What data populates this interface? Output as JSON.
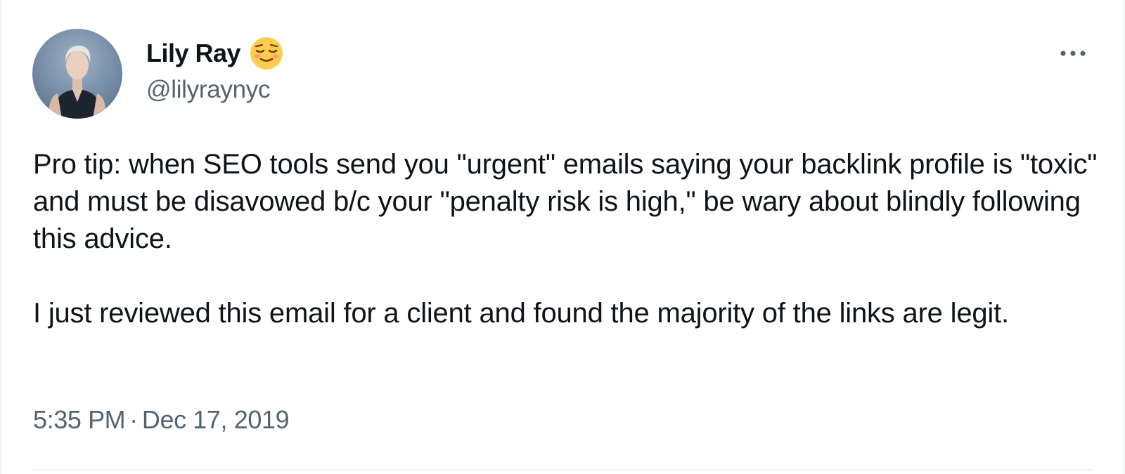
{
  "author": {
    "display_name": "Lily Ray",
    "handle": "@lilyraynyc",
    "avatar_icon": "profile-photo",
    "badge_icon": "relieved-face-emoji"
  },
  "more_icon": "more-horizontal-icon",
  "tweet": {
    "paragraphs": [
      "Pro tip: when SEO tools send you \"urgent\" emails saying your backlink profile is \"toxic\" and must be disavowed b/c your \"penalty risk is high,\" be wary about blindly following this advice.",
      "I just reviewed this email for a client and found the majority of the links are legit."
    ],
    "time": "5:35 PM",
    "separator": "·",
    "date": "Dec 17, 2019"
  },
  "colors": {
    "text_primary": "#0f1419",
    "text_secondary": "#536471",
    "divider": "#eff3f4",
    "emoji_face": "#ffcc4d"
  }
}
